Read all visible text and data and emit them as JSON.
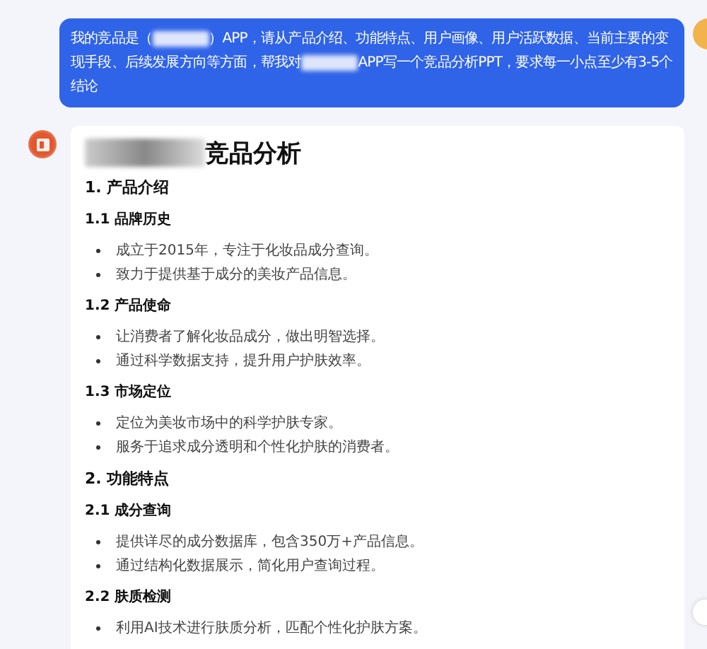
{
  "user_message": {
    "segments": [
      {
        "kind": "text",
        "text": "我的竞品是（"
      },
      {
        "kind": "redaction"
      },
      {
        "kind": "text",
        "text": "）APP，请从产品介绍、功能特点、用户画像、用户活跃数据、当前主要的变现手段、后续发展方向等方面，帮我对"
      },
      {
        "kind": "redaction"
      },
      {
        "kind": "text",
        "text": "APP写一个竞品分析PPT，要求每一小点至少有3-5个结论"
      }
    ]
  },
  "reply": {
    "title": {
      "segments": [
        {
          "kind": "redaction"
        },
        {
          "kind": "text",
          "text": "竞品分析"
        }
      ]
    },
    "blocks": [
      {
        "kind": "h1",
        "text": "1. 产品介绍"
      },
      {
        "kind": "h2",
        "text": "1.1 品牌历史"
      },
      {
        "kind": "bullet",
        "text": "成立于2015年，专注于化妆品成分查询。"
      },
      {
        "kind": "bullet",
        "text": "致力于提供基于成分的美妆产品信息。"
      },
      {
        "kind": "h2",
        "text": "1.2 产品使命"
      },
      {
        "kind": "bullet",
        "text": "让消费者了解化妆品成分，做出明智选择。"
      },
      {
        "kind": "bullet",
        "text": "通过科学数据支持，提升用户护肤效率。"
      },
      {
        "kind": "h2",
        "text": "1.3 市场定位"
      },
      {
        "kind": "bullet",
        "text": "定位为美妆市场中的科学护肤专家。"
      },
      {
        "kind": "bullet",
        "text": "服务于追求成分透明和个性化护肤的消费者。"
      },
      {
        "kind": "h1",
        "text": "2. 功能特点"
      },
      {
        "kind": "h2",
        "text": "2.1 成分查询"
      },
      {
        "kind": "bullet",
        "text": "提供详尽的成分数据库，包含350万+产品信息。"
      },
      {
        "kind": "bullet",
        "text": "通过结构化数据展示，简化用户查询过程。"
      },
      {
        "kind": "h2",
        "text": "2.2 肤质检测"
      },
      {
        "kind": "bullet",
        "text": "利用AI技术进行肤质分析，匹配个性化护肤方案。"
      }
    ]
  }
}
